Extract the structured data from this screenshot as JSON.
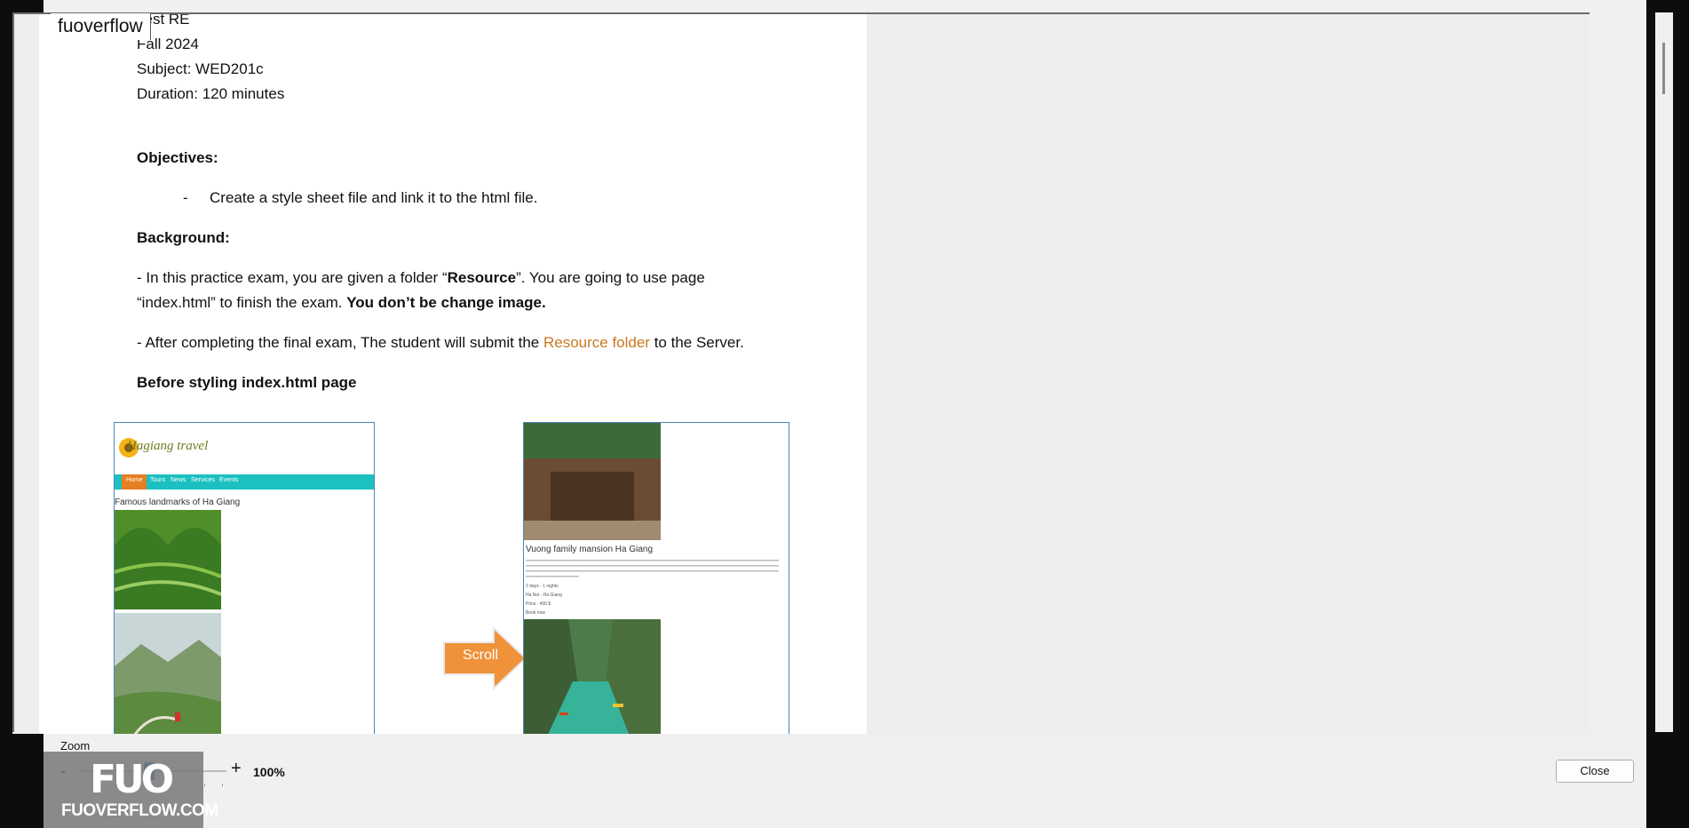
{
  "file_title": "fuoverflow",
  "document": {
    "line_top": "Test RE",
    "term": "Fall 2024",
    "subject": "Subject: WED201c",
    "duration": "Duration: 120 minutes",
    "objectives_heading": "Objectives:",
    "objective_dash": "-",
    "objective_1": "Create a style sheet file and link it to the html file.",
    "background_heading": "Background:",
    "bg1_prefix": "- In this practice exam, you are given a folder “",
    "bg1_bold": "Resource",
    "bg1_suffix": "”. You are going to use page",
    "bg2_prefix": "“index.html”  to finish the exam. ",
    "bg2_bold": "You don’t be change image.",
    "bg3_prefix": "- After completing the final exam, The student will submit the ",
    "bg3_link": "Resource folder",
    "bg3_suffix": " to the Server.",
    "before_heading": "Before styling index.html page"
  },
  "screenshot_left": {
    "brand": "Hagiang travel",
    "nav": [
      "Home",
      "Tours",
      "News",
      "Services",
      "Events"
    ],
    "caption": "Famous landmarks of Ha Giang"
  },
  "screenshot_right": {
    "title": "Vuong family mansion Ha Giang",
    "meta1": "2 days - 1 nights",
    "meta2": "Ha Noi - Ha Giang",
    "price": "Price : 400 $",
    "book": "Book now"
  },
  "scroll_label": "Scroll",
  "zoom": {
    "label": "Zoom",
    "minus": "-",
    "plus": "+",
    "value": "100%",
    "level_percent": 100
  },
  "close_label": "Close",
  "watermark": {
    "mark": "FUO",
    "site": "FUOVERFLOW.COM"
  },
  "colors": {
    "link": "#c8781e",
    "nav_bar": "#1cc0c0",
    "nav_active": "#e67e22",
    "scroll_arrow": "#f0923a"
  }
}
